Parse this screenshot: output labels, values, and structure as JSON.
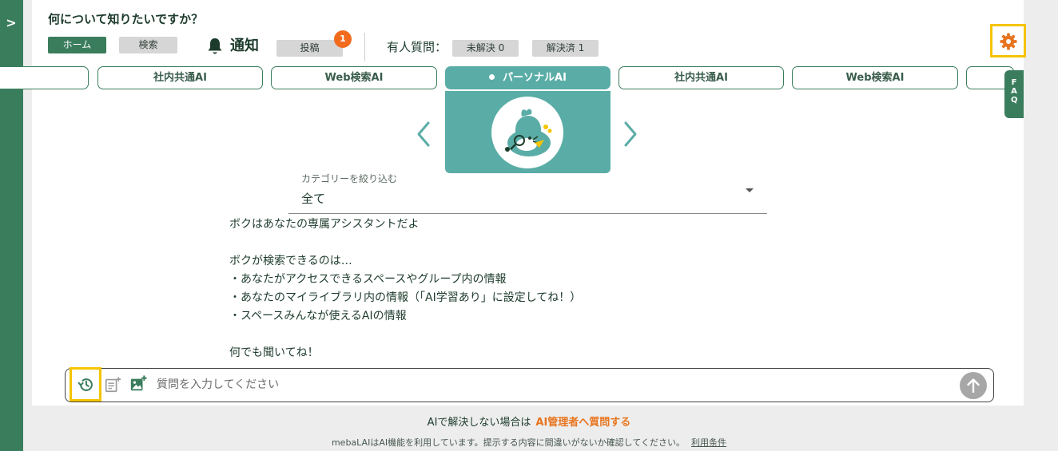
{
  "header": {
    "title": "何について知りたいですか？"
  },
  "nav": {
    "home": "ホーム",
    "search": "検索",
    "notify": "通知",
    "post": "投稿",
    "post_badge": "1",
    "human_label": "有人質問：",
    "unsolved": "未解決 0",
    "solved": "解決済 1"
  },
  "ai_tabs": [
    {
      "label": ""
    },
    {
      "label": "社内共通AI"
    },
    {
      "label": "Web検索AI"
    },
    {
      "label": "パーソナルAI",
      "active": true
    },
    {
      "label": "社内共通AI"
    },
    {
      "label": "Web検索AI"
    },
    {
      "label": ""
    }
  ],
  "faq": {
    "label": "F A Q"
  },
  "category": {
    "label": "カテゴリーを絞り込む",
    "value": "全て"
  },
  "message": {
    "lines": [
      "ボクはあなたの専属アシスタントだよ",
      "",
      "ボクが検索できるのは…",
      "・あなたがアクセスできるスペースやグループ内の情報",
      "・あなたのマイライブラリ内の情報（「AI学習あり」に設定してね！）",
      "・スペースみんなが使えるAIの情報",
      "",
      "何でも聞いてね！"
    ]
  },
  "input": {
    "placeholder": "質問を入力してください",
    "value": ""
  },
  "footer": {
    "prompt": "AIで解決しない場合は",
    "link": "AI管理者へ質問する",
    "disclaimer": "mebaLAIはAI機能を利用しています。提示する内容に間違いがないか確認してください。",
    "terms": "利用条件"
  },
  "icons": {
    "sidebar_toggle": "chevron-right-icon",
    "notify": "bell-icon",
    "settings": "gear-icon",
    "history": "history-icon",
    "attach_doc": "document-add-icon",
    "attach_image": "image-add-icon",
    "send": "arrow-up-icon",
    "prev": "chevron-left-icon",
    "next": "chevron-right-icon"
  },
  "colors": {
    "primary_green": "#3a7d5d",
    "teal": "#5aada6",
    "accent_orange": "#f26b1d",
    "highlight_yellow": "#f5c400"
  }
}
